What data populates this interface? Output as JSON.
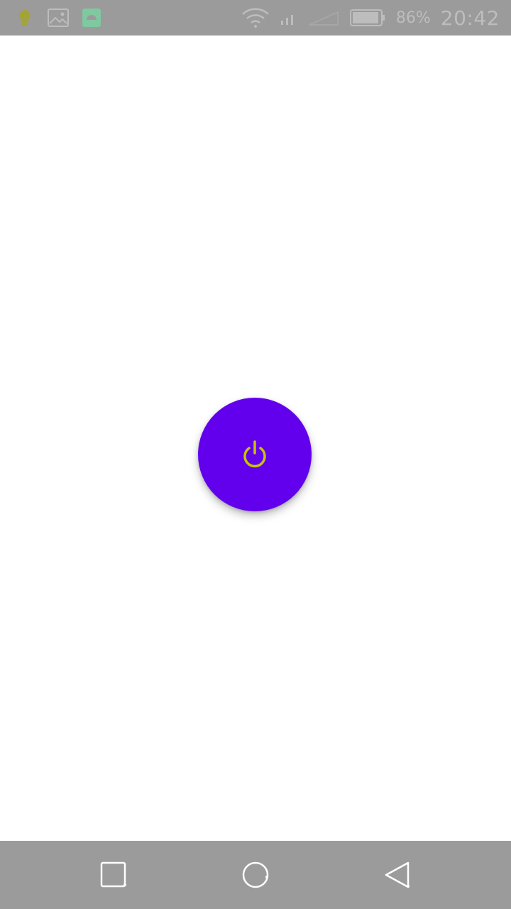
{
  "status_bar": {
    "battery_percent": "86%",
    "time": "20:42",
    "icons": {
      "notification_1": "lightbulb-icon",
      "notification_2": "image-icon",
      "notification_3": "android-icon",
      "wifi": "wifi-icon",
      "signal": "cell-signal-icon",
      "signal_2": "cell-signal-empty-icon",
      "battery": "battery-icon"
    },
    "colors": {
      "bar_background": "#9b9b9b",
      "icon_color": "#bdbdbd",
      "android_icon": "#7fc8a0",
      "bulb_icon": "#a3a33a"
    }
  },
  "main": {
    "power_button": {
      "icon": "power-icon",
      "background_color": "#6200ee",
      "icon_color": "#c8c400"
    }
  },
  "nav_bar": {
    "recents_icon": "recents-square-icon",
    "home_icon": "home-circle-icon",
    "back_icon": "back-triangle-icon",
    "background_color": "#9b9b9b"
  }
}
